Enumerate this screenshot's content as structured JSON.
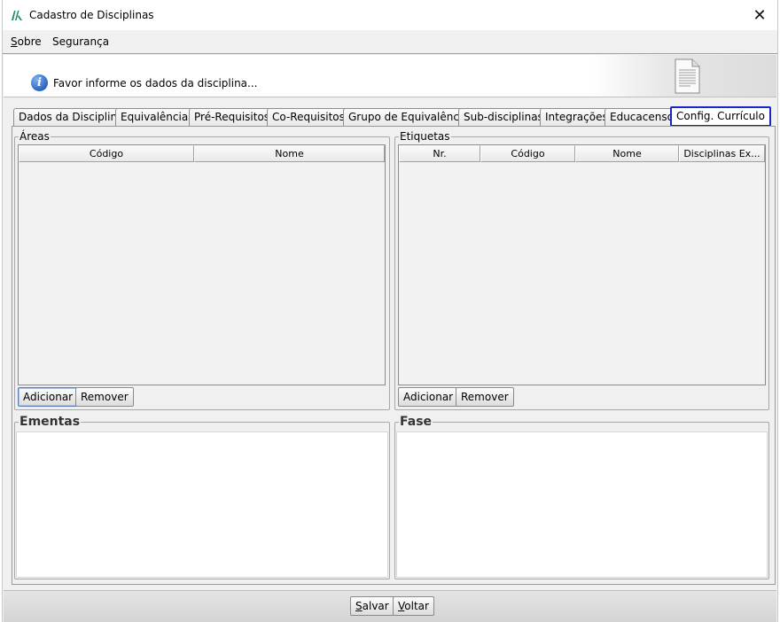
{
  "window": {
    "title": "Cadastro de Disciplinas",
    "close_glyph": "✕"
  },
  "menu": {
    "items": [
      {
        "label": "Sobre",
        "mnemonic": "S"
      },
      {
        "label": "Segurança",
        "mnemonic": ""
      }
    ]
  },
  "banner": {
    "message": "Favor informe os dados da disciplina...",
    "info_glyph": "i"
  },
  "tabs": [
    "Dados da Disciplina",
    "Equivalências",
    "Pré-Requisitos",
    "Co-Requisitos",
    "Grupo de Equivalência",
    "Sub-disciplinas",
    "Integrações",
    "Educacenso",
    "Config. Currículo"
  ],
  "active_tab": "Config. Currículo",
  "areas": {
    "legend": "Áreas",
    "columns": [
      "Código",
      "Nome"
    ],
    "rows": [],
    "add_label": "Adicionar",
    "remove_label": "Remover"
  },
  "etiquetas": {
    "legend": "Etiquetas",
    "columns": [
      "Nr.",
      "Código",
      "Nome",
      "Disciplinas Ex..."
    ],
    "rows": [],
    "add_label": "Adicionar",
    "remove_label": "Remover"
  },
  "ementas": {
    "legend": "Ementas",
    "value": ""
  },
  "fase": {
    "legend": "Fase",
    "value": ""
  },
  "footer": {
    "save_label": "Salvar",
    "back_label": "Voltar"
  },
  "colors": {
    "active_tab_border": "#1428c8",
    "window_bg": "#f0f0f0"
  }
}
